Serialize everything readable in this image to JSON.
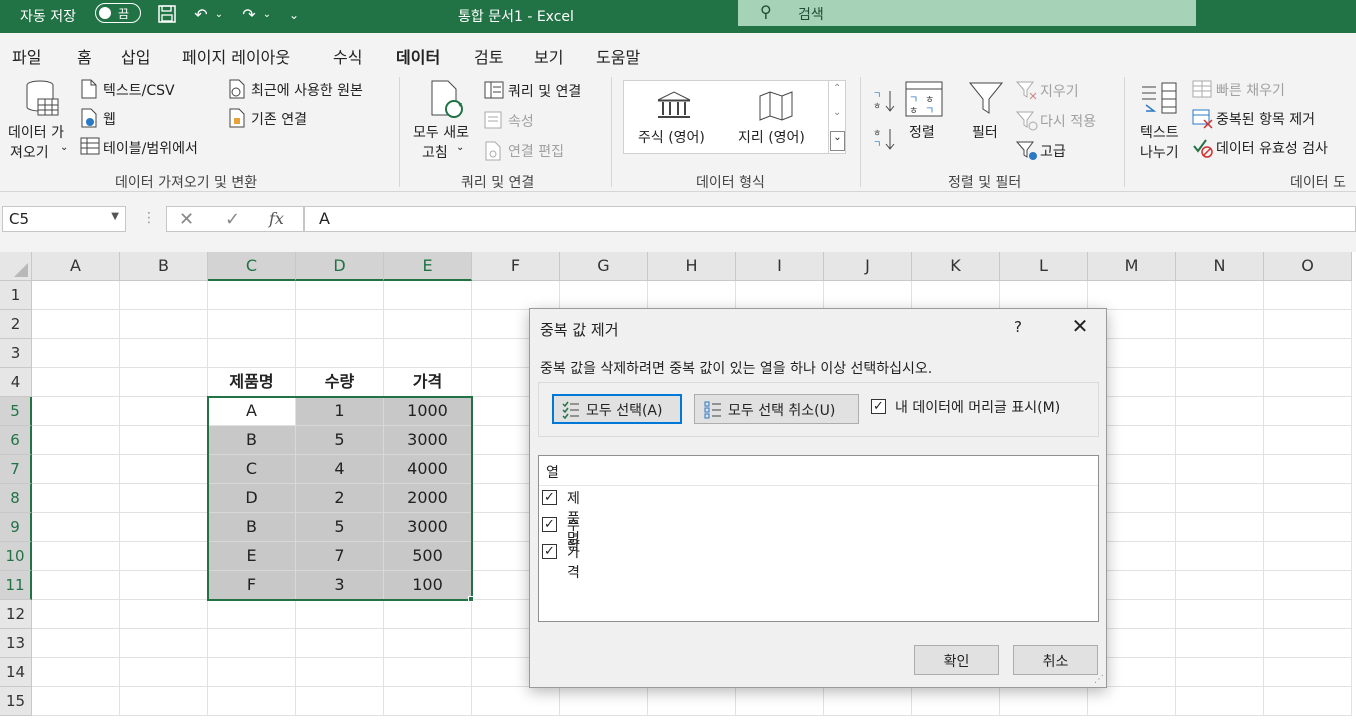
{
  "titlebar": {
    "autosave_label": "자동 저장",
    "autosave_state": "끔",
    "doc_title": "통합 문서1  -  Excel",
    "search_placeholder": "검색"
  },
  "tabs": [
    "파일",
    "홈",
    "삽입",
    "페이지 레이아웃",
    "수식",
    "데이터",
    "검토",
    "보기",
    "도움말"
  ],
  "active_tab": "데이터",
  "ribbon": {
    "get_data_line1": "데이터 가",
    "get_data_line2": "져오기",
    "text_csv": "텍스트/CSV",
    "web": "웹",
    "from_table": "테이블/범위에서",
    "recent_sources": "최근에 사용한 원본",
    "existing_connections": "기존 연결",
    "group1": "데이터 가져오기 및 변환",
    "refresh_line1": "모두 새로",
    "refresh_line2": "고침",
    "queries_connections": "쿼리 및 연결",
    "properties": "속성",
    "edit_links": "연결 편집",
    "group2": "쿼리 및 연결",
    "stocks": "주식 (영어)",
    "geography": "지리 (영어)",
    "group3": "데이터 형식",
    "sort": "정렬",
    "filter": "필터",
    "clear": "지우기",
    "reapply": "다시 적용",
    "advanced": "고급",
    "group4": "정렬 및 필터",
    "text_to_cols_line1": "텍스트",
    "text_to_cols_line2": "나누기",
    "flash_fill": "빠른 채우기",
    "remove_duplicates": "중복된 항목 제거",
    "data_validation": "데이터 유효성 검사",
    "group5": "데이터 도"
  },
  "formula_bar": {
    "name_box": "C5",
    "fx": "fx",
    "formula": "A"
  },
  "columns": [
    "A",
    "B",
    "C",
    "D",
    "E",
    "F",
    "G",
    "H",
    "I",
    "J",
    "K",
    "L",
    "M",
    "N",
    "O"
  ],
  "rows": [
    "1",
    "2",
    "3",
    "4",
    "5",
    "6",
    "7",
    "8",
    "9",
    "10",
    "11",
    "12",
    "13",
    "14",
    "15"
  ],
  "table": {
    "headers": [
      "제품명",
      "수량",
      "가격"
    ],
    "rows": [
      [
        "A",
        "1",
        "1000"
      ],
      [
        "B",
        "5",
        "3000"
      ],
      [
        "C",
        "4",
        "4000"
      ],
      [
        "D",
        "2",
        "2000"
      ],
      [
        "B",
        "5",
        "3000"
      ],
      [
        "E",
        "7",
        "500"
      ],
      [
        "F",
        "3",
        "100"
      ]
    ]
  },
  "dialog": {
    "title": "중복 값 제거",
    "help": "?",
    "instruction": "중복 값을 삭제하려면 중복 값이 있는 열을 하나 이상 선택하십시오.",
    "select_all": "모두 선택(A)",
    "unselect_all": "모두 선택 취소(U)",
    "has_headers": "내 데이터에 머리글 표시(M)",
    "has_headers_checked": true,
    "column_list_header": "열",
    "column_items": [
      {
        "label": "제품명",
        "checked": true
      },
      {
        "label": "수량",
        "checked": true
      },
      {
        "label": "가격",
        "checked": true
      }
    ],
    "ok": "확인",
    "cancel": "취소"
  }
}
